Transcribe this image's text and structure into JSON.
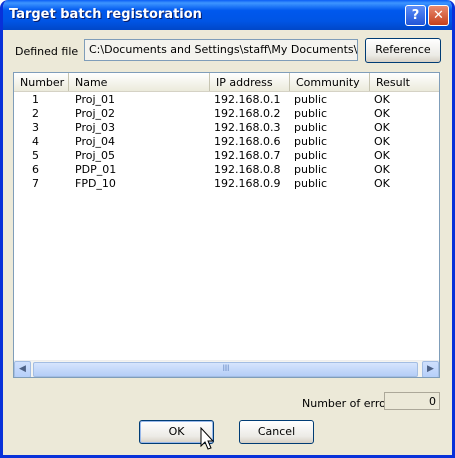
{
  "window": {
    "title": "Target batch registoration"
  },
  "titlebar": {
    "help_glyph": "?",
    "close_glyph": "✕"
  },
  "file": {
    "label": "Defined file",
    "value": "C:\\Documents and Settings\\staff\\My Documents\\IFDE\\",
    "reference_label": "Reference"
  },
  "table": {
    "columns": [
      "Number",
      "Name",
      "IP address",
      "Community",
      "Result"
    ],
    "rows": [
      {
        "number": "1",
        "name": "Proj_01",
        "ip": "192.168.0.1",
        "community": "public",
        "result": "OK"
      },
      {
        "number": "2",
        "name": "Proj_02",
        "ip": "192.168.0.2",
        "community": "public",
        "result": "OK"
      },
      {
        "number": "3",
        "name": "Proj_03",
        "ip": "192.168.0.3",
        "community": "public",
        "result": "OK"
      },
      {
        "number": "4",
        "name": "Proj_04",
        "ip": "192.168.0.6",
        "community": "public",
        "result": "OK"
      },
      {
        "number": "5",
        "name": "Proj_05",
        "ip": "192.168.0.7",
        "community": "public",
        "result": "OK"
      },
      {
        "number": "6",
        "name": "PDP_01",
        "ip": "192.168.0.8",
        "community": "public",
        "result": "OK"
      },
      {
        "number": "7",
        "name": "FPD_10",
        "ip": "192.168.0.9",
        "community": "public",
        "result": "OK"
      }
    ]
  },
  "scrollbar": {
    "left_glyph": "◀",
    "right_glyph": "▶",
    "grip": "IIII"
  },
  "errors": {
    "label": "Number of error",
    "value": "0"
  },
  "buttons": {
    "ok_label": "OK",
    "cancel_label": "Cancel"
  },
  "colors": {
    "titlebar": "#0055e5",
    "dialog": "#ece9d8",
    "field_border": "#7f9db9"
  },
  "icons": [
    "help-icon",
    "close-icon",
    "scroll-left-icon",
    "scroll-right-icon",
    "mouse-cursor-icon"
  ]
}
